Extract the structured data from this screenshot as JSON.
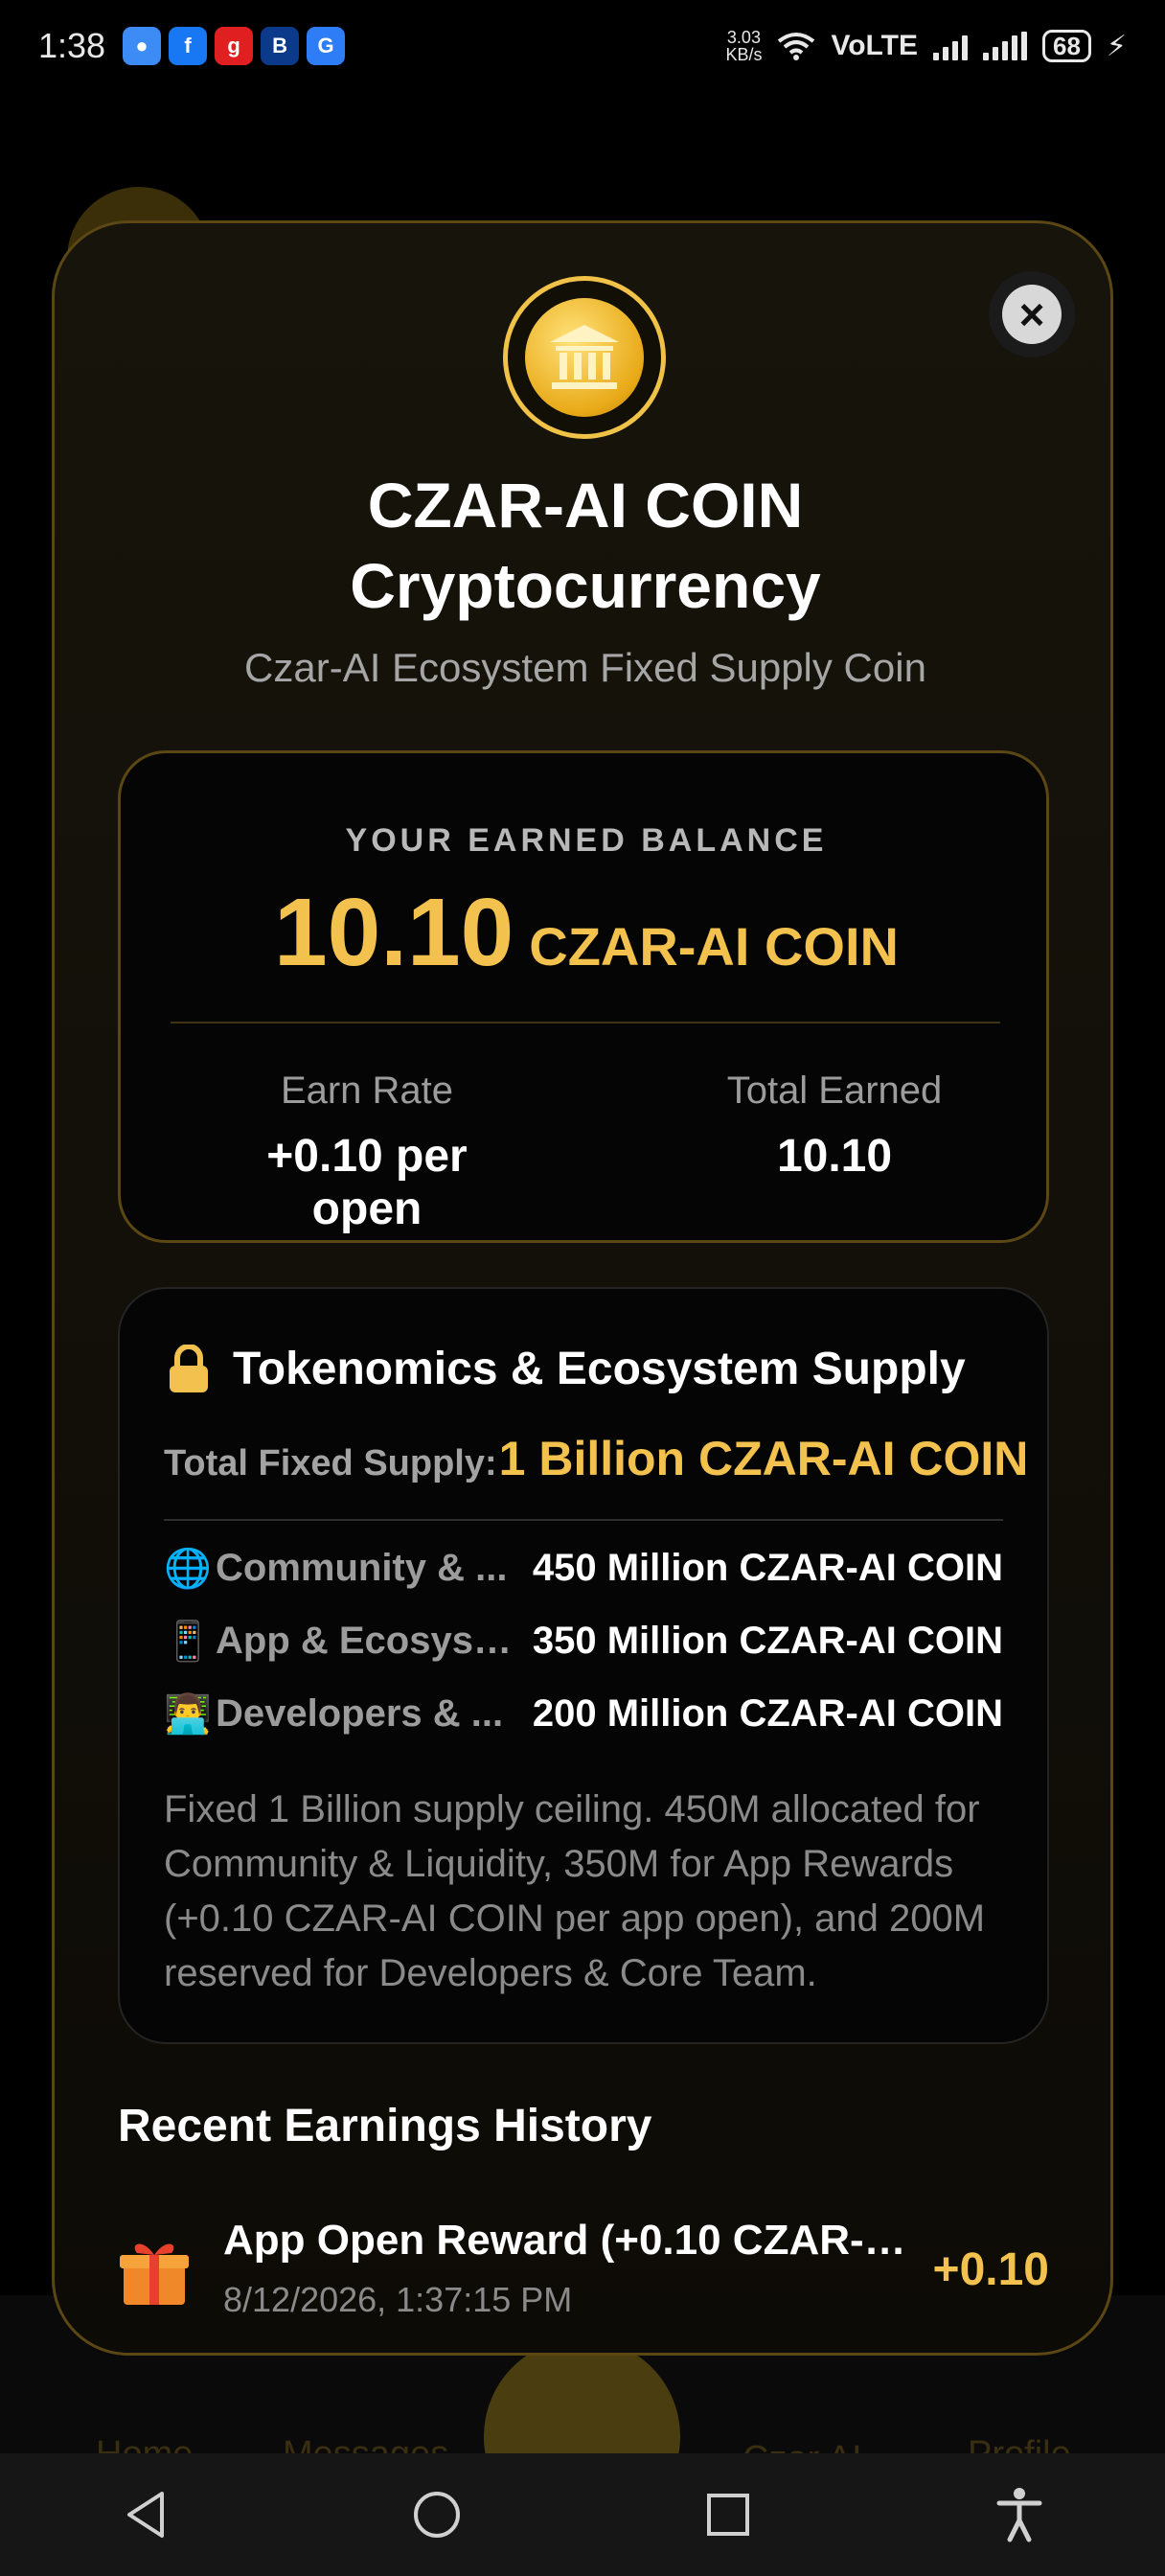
{
  "status_bar": {
    "time": "1:38",
    "net_speed_value": "3.03",
    "net_speed_unit": "KB/s",
    "network_label": "VoLTE",
    "battery": "68"
  },
  "background_nav": {
    "home": "Home",
    "messages": "Messages",
    "czar_ai": "Czar AI",
    "profile": "Profile"
  },
  "modal": {
    "title_line1": "CZAR-AI COIN",
    "title_line2": "Cryptocurrency",
    "subtitle": "Czar-AI Ecosystem Fixed Supply Coin",
    "balance": {
      "label": "YOUR EARNED BALANCE",
      "amount": "10.10",
      "unit": "CZAR-AI COIN",
      "earn_rate_label": "Earn Rate",
      "earn_rate_value": "+0.10 per open",
      "total_earned_label": "Total Earned",
      "total_earned_value": "10.10"
    },
    "tokenomics": {
      "title": "Tokenomics & Ecosystem Supply",
      "supply_label": "Total Fixed Supply:",
      "supply_value": "1 Billion CZAR-AI COIN",
      "allocations": [
        {
          "icon": "🌐",
          "name": "Community & ...",
          "amount": "450 Million CZAR-AI COIN"
        },
        {
          "icon": "📱",
          "name": "App & Ecosyst...",
          "amount": "350 Million CZAR-AI COIN"
        },
        {
          "icon": "👨‍💻",
          "name": "Developers & ...",
          "amount": "200 Million CZAR-AI COIN"
        }
      ],
      "description": "Fixed 1 Billion supply ceiling. 450M allocated for Community & Liquidity, 350M for App Rewards (+0.10 CZAR-AI COIN per app open), and 200M reserved for Developers & Core Team."
    },
    "history": {
      "title": "Recent Earnings History",
      "items": [
        {
          "label": "App Open Reward (+0.10 CZAR-A...",
          "date": "8/12/2026, 1:37:15 PM",
          "amount": "+0.10"
        }
      ]
    }
  },
  "colors": {
    "accent_gold": "#f2c14e",
    "border_gold": "#5a4714",
    "background": "#000000"
  },
  "icons": {
    "close": "close-icon",
    "coin": "bank-coin-icon",
    "lock": "lock-icon",
    "gift": "gift-icon"
  }
}
